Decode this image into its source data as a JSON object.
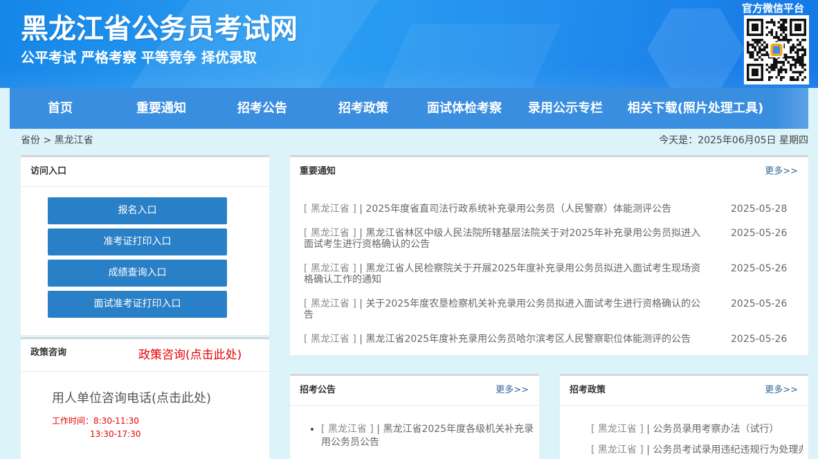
{
  "header": {
    "title": "黑龙江省公务员考试网",
    "slogan": "公平考试 严格考察 平等竞争 择优录取",
    "wechat_label": "官方微信平台"
  },
  "nav": {
    "items": [
      "首页",
      "重要通知",
      "招考公告",
      "招考政策",
      "面试体检考察",
      "录用公示专栏",
      "相关下载(照片处理工具)"
    ]
  },
  "breadcrumb": {
    "items": [
      "省份",
      "黑龙江省"
    ],
    "separator": ">"
  },
  "today": "今天是：2025年06月05日 星期四",
  "access": {
    "title": "访问入口",
    "buttons": [
      "报名入口",
      "准考证打印入口",
      "成绩查询入口",
      "面试准考证打印入口"
    ]
  },
  "consult": {
    "title": "政策咨询",
    "link": "政策咨询(点击此处)",
    "phone_link": "用人单位咨询电话(点击此处)",
    "hours_morning": "工作时间：8:30-11:30",
    "hours_afternoon": "13:30-17:30"
  },
  "notices": {
    "title": "重要通知",
    "more": "更多>>",
    "items": [
      {
        "region": "[ 黑龙江省 ]",
        "separator": "|",
        "title": "2025年度省直司法行政系统补充录用公务员（人民警察）体能测评公告",
        "date": "2025-05-28"
      },
      {
        "region": "[ 黑龙江省 ]",
        "separator": "|",
        "title": "黑龙江省林区中级人民法院所辖基层法院关于对2025年补充录用公务员拟进入面试考生进行资格确认的公告",
        "date": "2025-05-26"
      },
      {
        "region": "[ 黑龙江省 ]",
        "separator": "|",
        "title": "黑龙江省人民检察院关于开展2025年度补充录用公务员拟进入面试考生现场资格确认工作的通知",
        "date": "2025-05-26"
      },
      {
        "region": "[ 黑龙江省 ]",
        "separator": "|",
        "title": "关于2025年度农垦检察机关补充录用公务员拟进入面试考生进行资格确认的公告",
        "date": "2025-05-26"
      },
      {
        "region": "[ 黑龙江省 ]",
        "separator": "|",
        "title": "黑龙江省2025年度补充录用公务员哈尔滨考区人民警察职位体能测评的公告",
        "date": "2025-05-26"
      }
    ]
  },
  "announcements": {
    "title": "招考公告",
    "more": "更多>>",
    "items": [
      {
        "region": "[ 黑龙江省 ]",
        "separator": "|",
        "title": "黑龙江省2025年度各级机关补充录用公务员公告"
      }
    ]
  },
  "policies": {
    "title": "招考政策",
    "more": "更多>>",
    "items": [
      {
        "region": "[ 黑龙江省 ]",
        "separator": "|",
        "title": "公务员录用考察办法（试行）"
      },
      {
        "region": "[ 黑龙江省 ]",
        "separator": "|",
        "title": "公务员考试录用违纪违规行为处理办"
      }
    ]
  },
  "icons": {
    "wechat_qr": "qr-code-icon"
  },
  "colors": {
    "page_background": "#dbf3f9",
    "nav_blue": "#3a8ee0",
    "button_blue": "#2a80c7",
    "accent_red": "#e60000",
    "more_link": "#336699",
    "list_text": "#666666"
  }
}
